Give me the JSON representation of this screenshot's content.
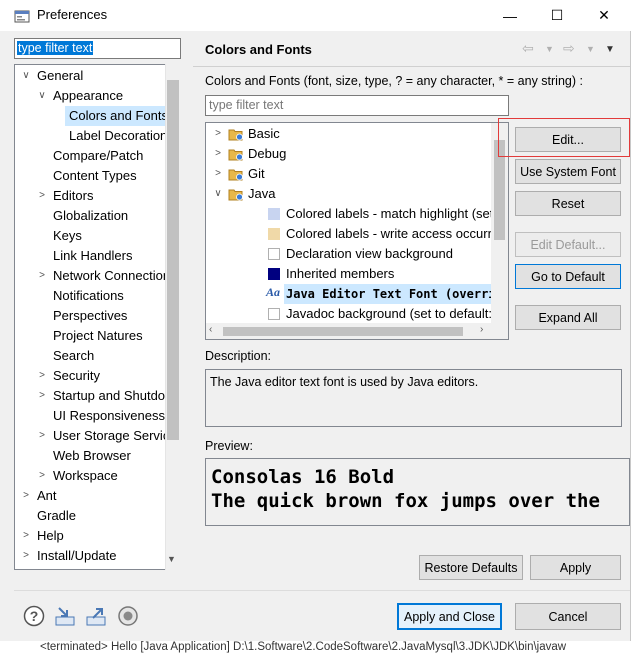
{
  "window": {
    "title": "Preferences",
    "minimize": "—",
    "maximize": "☐",
    "close": "✕"
  },
  "left": {
    "filter_text": "type filter text",
    "tree": [
      {
        "label": "General",
        "arrow": "∨",
        "level": 0
      },
      {
        "label": "Appearance",
        "arrow": "∨",
        "level": 1
      },
      {
        "label": "Colors and Fonts",
        "arrow": "",
        "level": 2,
        "selected": true
      },
      {
        "label": "Label Decorations",
        "arrow": "",
        "level": 2
      },
      {
        "label": "Compare/Patch",
        "arrow": "",
        "level": 1
      },
      {
        "label": "Content Types",
        "arrow": "",
        "level": 1
      },
      {
        "label": "Editors",
        "arrow": ">",
        "level": 1
      },
      {
        "label": "Globalization",
        "arrow": "",
        "level": 1
      },
      {
        "label": "Keys",
        "arrow": "",
        "level": 1
      },
      {
        "label": "Link Handlers",
        "arrow": "",
        "level": 1
      },
      {
        "label": "Network Connections",
        "arrow": ">",
        "level": 1
      },
      {
        "label": "Notifications",
        "arrow": "",
        "level": 1
      },
      {
        "label": "Perspectives",
        "arrow": "",
        "level": 1
      },
      {
        "label": "Project Natures",
        "arrow": "",
        "level": 1
      },
      {
        "label": "Search",
        "arrow": "",
        "level": 1
      },
      {
        "label": "Security",
        "arrow": ">",
        "level": 1
      },
      {
        "label": "Startup and Shutdown",
        "arrow": ">",
        "level": 1
      },
      {
        "label": "UI Responsiveness",
        "arrow": "",
        "level": 1
      },
      {
        "label": "User Storage Service",
        "arrow": ">",
        "level": 1
      },
      {
        "label": "Web Browser",
        "arrow": "",
        "level": 1
      },
      {
        "label": "Workspace",
        "arrow": ">",
        "level": 1
      },
      {
        "label": "Ant",
        "arrow": ">",
        "level": 0
      },
      {
        "label": "Gradle",
        "arrow": "",
        "level": 0
      },
      {
        "label": "Help",
        "arrow": ">",
        "level": 0
      },
      {
        "label": "Install/Update",
        "arrow": ">",
        "level": 0
      }
    ]
  },
  "page": {
    "title": "Colors and Fonts",
    "subtitle": "Colors and Fonts (font, size, type, ? = any character, * = any string) :",
    "filter_placeholder": "type filter text",
    "items": [
      {
        "label": "Basic",
        "arrow": ">",
        "kind": "folder",
        "level": 0
      },
      {
        "label": "Debug",
        "arrow": ">",
        "kind": "folder",
        "level": 0
      },
      {
        "label": "Git",
        "arrow": ">",
        "kind": "folder",
        "level": 0
      },
      {
        "label": "Java",
        "arrow": "∨",
        "kind": "folder",
        "level": 0
      },
      {
        "label": "Colored labels - match highlight (set to",
        "kind": "swatch",
        "color": "#c8d4f0",
        "level": 1
      },
      {
        "label": "Colored labels - write access occurrence",
        "kind": "swatch",
        "color": "#f0d9a8",
        "level": 1
      },
      {
        "label": "Declaration view background",
        "kind": "swatch",
        "color": "#ffffff",
        "level": 1
      },
      {
        "label": "Inherited members",
        "kind": "swatch",
        "color": "#000080",
        "level": 1
      },
      {
        "label": "Java Editor Text Font (overrides",
        "kind": "font",
        "icon_text": "Aa",
        "level": 1,
        "selected": true
      },
      {
        "label": "Javadoc background (set to default: Inf",
        "kind": "swatch",
        "color": "#ffffff",
        "level": 1
      }
    ],
    "buttons": {
      "edit": "Edit...",
      "use_system_font": "Use System Font",
      "reset": "Reset",
      "edit_default": "Edit Default...",
      "go_to_default": "Go to Default",
      "expand_all": "Expand All"
    },
    "description_label": "Description:",
    "description_text": "The Java editor text font is used by Java editors.",
    "preview_label": "Preview:",
    "preview_lines": [
      "Consolas 16 Bold",
      "The quick brown fox jumps over the"
    ],
    "restore_defaults": "Restore Defaults",
    "apply": "Apply"
  },
  "footer": {
    "apply_and_close": "Apply and Close",
    "cancel": "Cancel",
    "icons": [
      "help-icon",
      "import-icon",
      "export-icon",
      "oomph-icon"
    ]
  },
  "statusbar": {
    "text": "<terminated> Hello [Java Application] D:\\1.Software\\2.CodeSoftware\\2.JavaMysql\\3.JDK\\JDK\\bin\\javaw"
  },
  "colors": {
    "accent": "#0078d7",
    "selection": "#cce8ff",
    "highlight_box": "#e23b3b"
  }
}
